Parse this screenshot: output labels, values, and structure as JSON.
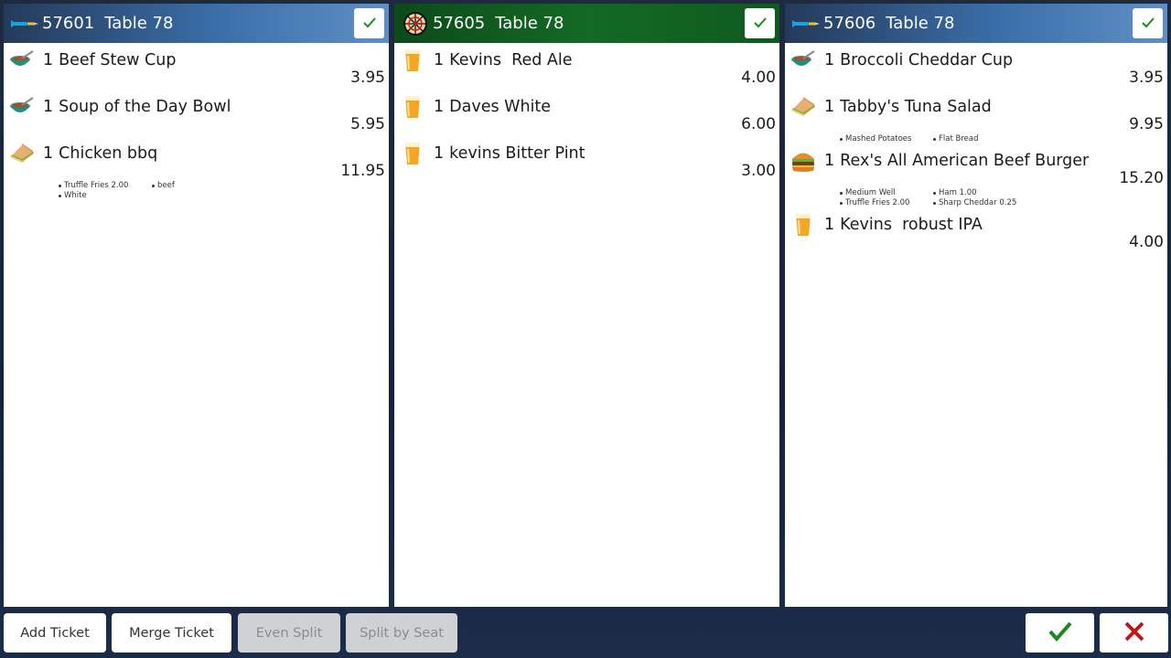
{
  "tickets": [
    {
      "number": "57601",
      "table": "Table 78",
      "header_icon": "dart-icon",
      "header_color": "#3a6ea8",
      "items": [
        {
          "qty": "1",
          "name": "Beef Stew Cup",
          "price": "3.95",
          "icon": "soup-icon",
          "mods": []
        },
        {
          "qty": "1",
          "name": "Soup of the Day Bowl",
          "price": "5.95",
          "icon": "soup-icon",
          "mods": []
        },
        {
          "qty": "1",
          "name": "Chicken bbq",
          "price": "11.95",
          "icon": "sandwich-icon",
          "mods": [
            "Truffle Fries 2.00",
            "beef",
            "White"
          ]
        }
      ]
    },
    {
      "number": "57605",
      "table": "Table 78",
      "header_icon": "dartboard-icon",
      "header_color": "#136a24",
      "items": [
        {
          "qty": "1",
          "name": "Kevins  Red Ale",
          "price": "4.00",
          "icon": "beer-icon",
          "mods": []
        },
        {
          "qty": "1",
          "name": "Daves White",
          "price": "6.00",
          "icon": "beer-icon",
          "mods": []
        },
        {
          "qty": "1",
          "name": "kevins Bitter Pint",
          "price": "3.00",
          "icon": "beer-icon",
          "mods": []
        }
      ]
    },
    {
      "number": "57606",
      "table": "Table 78",
      "header_icon": "dart-icon",
      "header_color": "#3a6ea8",
      "items": [
        {
          "qty": "1",
          "name": "Broccoli Cheddar Cup",
          "price": "3.95",
          "icon": "soup-icon",
          "mods": []
        },
        {
          "qty": "1",
          "name": "Tabby's Tuna Salad",
          "price": "9.95",
          "icon": "sandwich-icon",
          "mods": [
            "Mashed Potatoes",
            "Flat Bread"
          ]
        },
        {
          "qty": "1",
          "name": "Rex's All American Beef Burger",
          "price": "15.20",
          "icon": "burger-icon",
          "mods": [
            "Medium Well",
            "Ham 1.00",
            "Truffle Fries 2.00",
            "Sharp Cheddar 0.25"
          ]
        },
        {
          "qty": "1",
          "name": "Kevins  robust IPA",
          "price": "4.00",
          "icon": "beer-icon",
          "mods": []
        }
      ]
    }
  ],
  "toolbar": {
    "add_ticket": "Add Ticket",
    "merge_ticket": "Merge Ticket",
    "even_split": "Even Split",
    "split_by_seat": "Split by Seat"
  },
  "colors": {
    "confirm": "#1a8a1a",
    "cancel": "#c01818"
  }
}
